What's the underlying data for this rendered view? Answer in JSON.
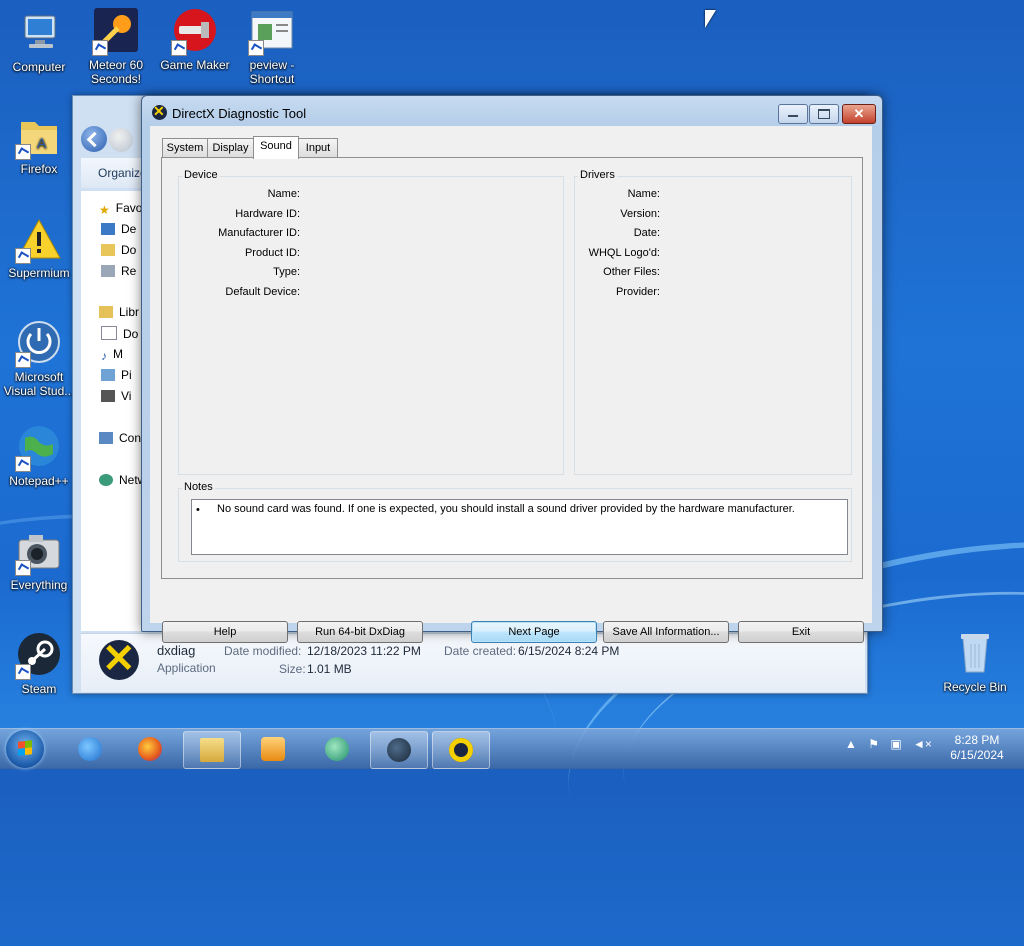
{
  "desktop": {
    "icons": [
      {
        "label": "Computer",
        "icon": "computer-icon"
      },
      {
        "label": "Meteor 60 Seconds!",
        "icon": "meteor-icon"
      },
      {
        "label": "Game Maker",
        "icon": "game-maker-icon"
      },
      {
        "label": "peview - Shortcut",
        "icon": "peview-icon"
      },
      {
        "label": "Firefox",
        "icon": "folder-icon"
      },
      {
        "label": "Supermium",
        "icon": "warning-icon"
      },
      {
        "label": "Microsoft Visual Stud...",
        "icon": "power-icon"
      },
      {
        "label": "Notepad++",
        "icon": "globe-icon"
      },
      {
        "label": "Everything",
        "icon": "camera-icon"
      },
      {
        "label": "Steam",
        "icon": "steam-icon"
      },
      {
        "label": "Recycle Bin",
        "icon": "recycle-bin-icon"
      }
    ]
  },
  "explorer": {
    "organize": "Organize",
    "nav_items": [
      "Favo",
      "De",
      "Do",
      "Re",
      "Libr",
      "Do",
      "M",
      "Pi",
      "Vi",
      "Con",
      "Netw"
    ],
    "details": {
      "name": "dxdiag",
      "type": "Application",
      "date_modified_label": "Date modified:",
      "date_modified": "12/18/2023 11:22 PM",
      "size_label": "Size:",
      "size": "1.01 MB",
      "date_created_label": "Date created:",
      "date_created": "6/15/2024 8:24 PM"
    }
  },
  "dialog": {
    "title": "DirectX Diagnostic Tool",
    "tabs": [
      "System",
      "Display",
      "Sound",
      "Input"
    ],
    "active_tab": "Sound",
    "device": {
      "label": "Device",
      "fields": [
        "Name:",
        "Hardware ID:",
        "Manufacturer ID:",
        "Product ID:",
        "Type:",
        "Default Device:"
      ]
    },
    "drivers": {
      "label": "Drivers",
      "fields": [
        "Name:",
        "Version:",
        "Date:",
        "WHQL Logo'd:",
        "Other Files:",
        "Provider:"
      ]
    },
    "notes": {
      "label": "Notes",
      "bullet": "•",
      "text": "No sound card was found.  If one is expected, you should install a sound driver provided by the hardware manufacturer."
    },
    "buttons": {
      "help": "Help",
      "run64": "Run 64-bit DxDiag",
      "next": "Next Page",
      "save": "Save All Information...",
      "exit": "Exit"
    }
  },
  "taskbar": {
    "clock_time": "8:28 PM",
    "clock_date": "6/15/2024"
  },
  "colors": {
    "desktop": "#1f73d6",
    "dialog_frame": "#bcd4ee",
    "default_button": "#bee6fd"
  }
}
